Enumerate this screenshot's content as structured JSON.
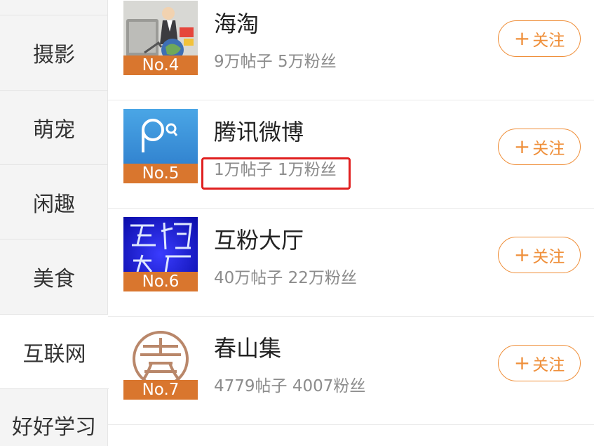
{
  "sidebar": {
    "items": [
      {
        "label": "摄影"
      },
      {
        "label": "萌宠"
      },
      {
        "label": "闲趣"
      },
      {
        "label": "美食"
      },
      {
        "label": "互联网",
        "active": true
      },
      {
        "label": "好好学习"
      }
    ]
  },
  "list": {
    "follow_label": "关注",
    "follow_plus": "+",
    "rows": [
      {
        "name": "海淘",
        "stats": "9万帖子 5万粉丝",
        "rank": "No.4"
      },
      {
        "name": "腾讯微博",
        "stats": "1万帖子 1万粉丝",
        "rank": "No.5",
        "highlighted": true
      },
      {
        "name": "互粉大厅",
        "stats": "40万帖子 22万粉丝",
        "rank": "No.6"
      },
      {
        "name": "春山集",
        "stats": "4779帖子 4007粉丝",
        "rank": "No.7"
      }
    ]
  },
  "colors": {
    "accent": "#ef8f3a",
    "rank_bg": "#d9762e",
    "highlight": "#e02020"
  }
}
